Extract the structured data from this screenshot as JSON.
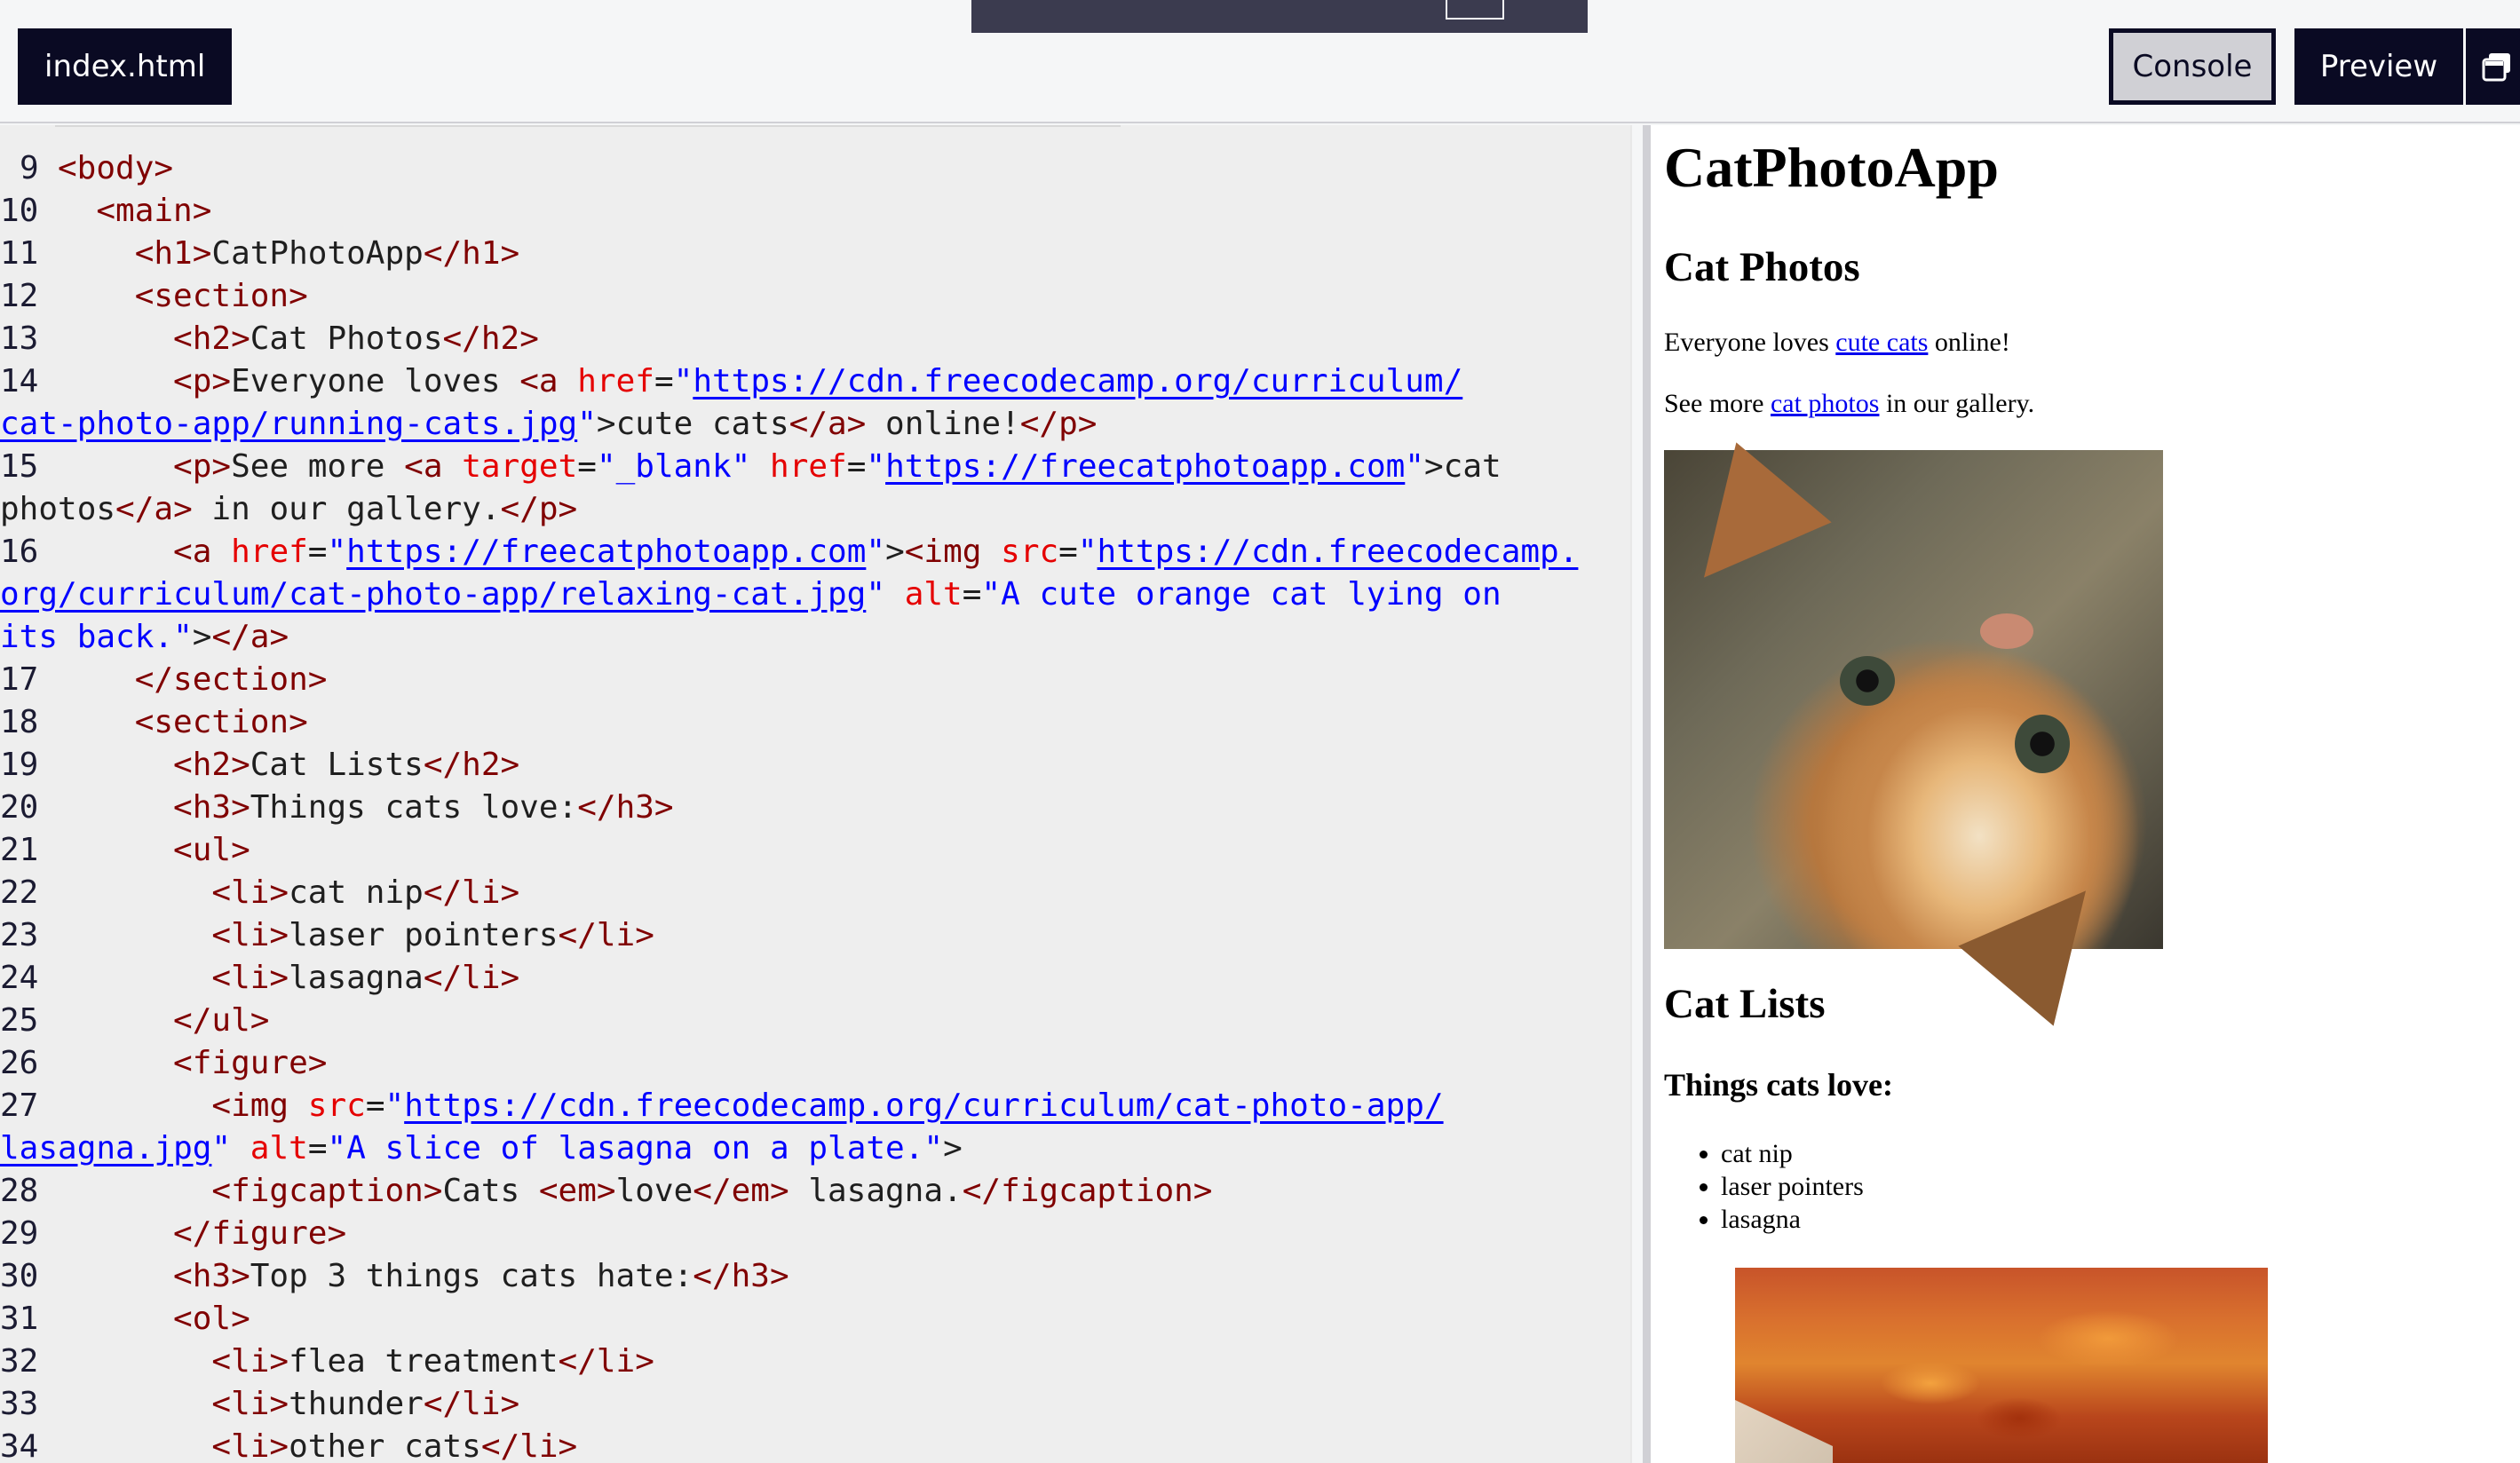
{
  "top_bar": {
    "file_tab": "index.html",
    "console_button": "Console",
    "preview_button": "Preview"
  },
  "editor": {
    "lines": [
      {
        "num": "9",
        "html": "  <span class='tag'>&lt;body&gt;</span>"
      },
      {
        "num": "10",
        "html": "    <span class='tag'>&lt;main&gt;</span>"
      },
      {
        "num": "11",
        "html": "      <span class='tag'>&lt;h1&gt;</span>CatPhotoApp<span class='tag'>&lt;/h1&gt;</span>"
      },
      {
        "num": "12",
        "html": "      <span class='tag'>&lt;section&gt;</span>"
      },
      {
        "num": "13",
        "html": "        <span class='tag'>&lt;h2&gt;</span>Cat Photos<span class='tag'>&lt;/h2&gt;</span>"
      }
    ],
    "line_texts": [
      {
        "num": "9",
        "text": "<body>"
      },
      {
        "num": "10",
        "text": "<main>"
      },
      {
        "num": "11",
        "text": "<h1>CatPhotoApp</h1>"
      },
      {
        "num": "12",
        "text": "<section>"
      },
      {
        "num": "13",
        "text": "<h2>Cat Photos</h2>"
      },
      {
        "num": "14",
        "text": "<p>Everyone loves <a href=\"https://cdn.freecodecamp.org/curriculum/cat-photo-app/running-cats.jpg\">cute cats</a> online!</p>"
      },
      {
        "num": "15",
        "text": "<p>See more <a target=\"_blank\" href=\"https://freecatphotoapp.com\">cat photos</a> in our gallery.</p>"
      },
      {
        "num": "16",
        "text": "<a href=\"https://freecatphotoapp.com\"><img src=\"https://cdn.freecodecamp.org/curriculum/cat-photo-app/relaxing-cat.jpg\" alt=\"A cute orange cat lying on its back.\"></a>"
      },
      {
        "num": "17",
        "text": "</section>"
      },
      {
        "num": "18",
        "text": "<section>"
      },
      {
        "num": "19",
        "text": "<h2>Cat Lists</h2>"
      },
      {
        "num": "20",
        "text": "<h3>Things cats love:</h3>"
      },
      {
        "num": "21",
        "text": "<ul>"
      },
      {
        "num": "22",
        "text": "<li>cat nip</li>"
      },
      {
        "num": "23",
        "text": "<li>laser pointers</li>"
      },
      {
        "num": "24",
        "text": "<li>lasagna</li>"
      },
      {
        "num": "25",
        "text": "</ul>"
      },
      {
        "num": "26",
        "text": "<figure>"
      },
      {
        "num": "27",
        "text": "<img src=\"https://cdn.freecodecamp.org/curriculum/cat-photo-app/lasagna.jpg\" alt=\"A slice of lasagna on a plate.\">"
      },
      {
        "num": "28",
        "text": "<figcaption>Cats <em>love</em> lasagna.</figcaption>"
      },
      {
        "num": "29",
        "text": "</figure>"
      },
      {
        "num": "30",
        "text": "<h3>Top 3 things cats hate:</h3>"
      },
      {
        "num": "31",
        "text": "<ol>"
      },
      {
        "num": "32",
        "text": "<li>flea treatment</li>"
      },
      {
        "num": "33",
        "text": "<li>thunder</li>"
      },
      {
        "num": "34",
        "text": "<li>other cats</li>"
      }
    ]
  },
  "preview": {
    "h1": "CatPhotoApp",
    "h2_photos": "Cat Photos",
    "p1_before": "Everyone loves ",
    "p1_link": "cute cats",
    "p1_after": " online!",
    "p2_before": "See more ",
    "p2_link": "cat photos",
    "p2_after": " in our gallery.",
    "img1_alt": "A cute orange cat lying on its back.",
    "h2_lists": "Cat Lists",
    "h3_love": "Things cats love:",
    "love_items": [
      "cat nip",
      "laser pointers",
      "lasagna"
    ],
    "img2_alt": "A slice of lasagna on a plate."
  },
  "colors": {
    "dark": "#0a0a23",
    "editor_bg": "#eeeeee",
    "tag": "#800000",
    "attr": "#e50000",
    "string": "#0000ff"
  }
}
